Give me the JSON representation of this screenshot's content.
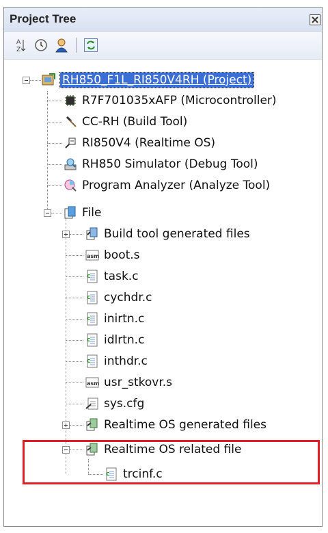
{
  "panel": {
    "title": "Project Tree"
  },
  "toolbar": {
    "buttons": [
      {
        "name": "sort-az-icon"
      },
      {
        "name": "history-icon"
      },
      {
        "name": "user-icon"
      },
      {
        "name": "refresh-icon"
      }
    ]
  },
  "tree": {
    "project": "RH850_F1L_RI850V4RH (Project)",
    "microcontroller": "R7F701035xAFP (Microcontroller)",
    "build_tool": "CC-RH (Build Tool)",
    "realtime_os": "RI850V4 (Realtime OS)",
    "debug_tool": "RH850 Simulator (Debug Tool)",
    "analyze_tool": "Program Analyzer (Analyze Tool)",
    "file": "File",
    "files": {
      "build_generated": "Build tool generated files",
      "boot": "boot.s",
      "task": "task.c",
      "cychdr": "cychdr.c",
      "inirtn": "inirtn.c",
      "idlrtn": "idlrtn.c",
      "inthdr": "inthdr.c",
      "usr_stkovr": "usr_stkovr.s",
      "sys_cfg": "sys.cfg",
      "os_generated": "Realtime OS generated files",
      "os_related": "Realtime OS related file",
      "trcinf": "trcinf.c"
    }
  },
  "colors": {
    "selection": "#3b6fd6",
    "highlight_border": "#e21d24"
  }
}
